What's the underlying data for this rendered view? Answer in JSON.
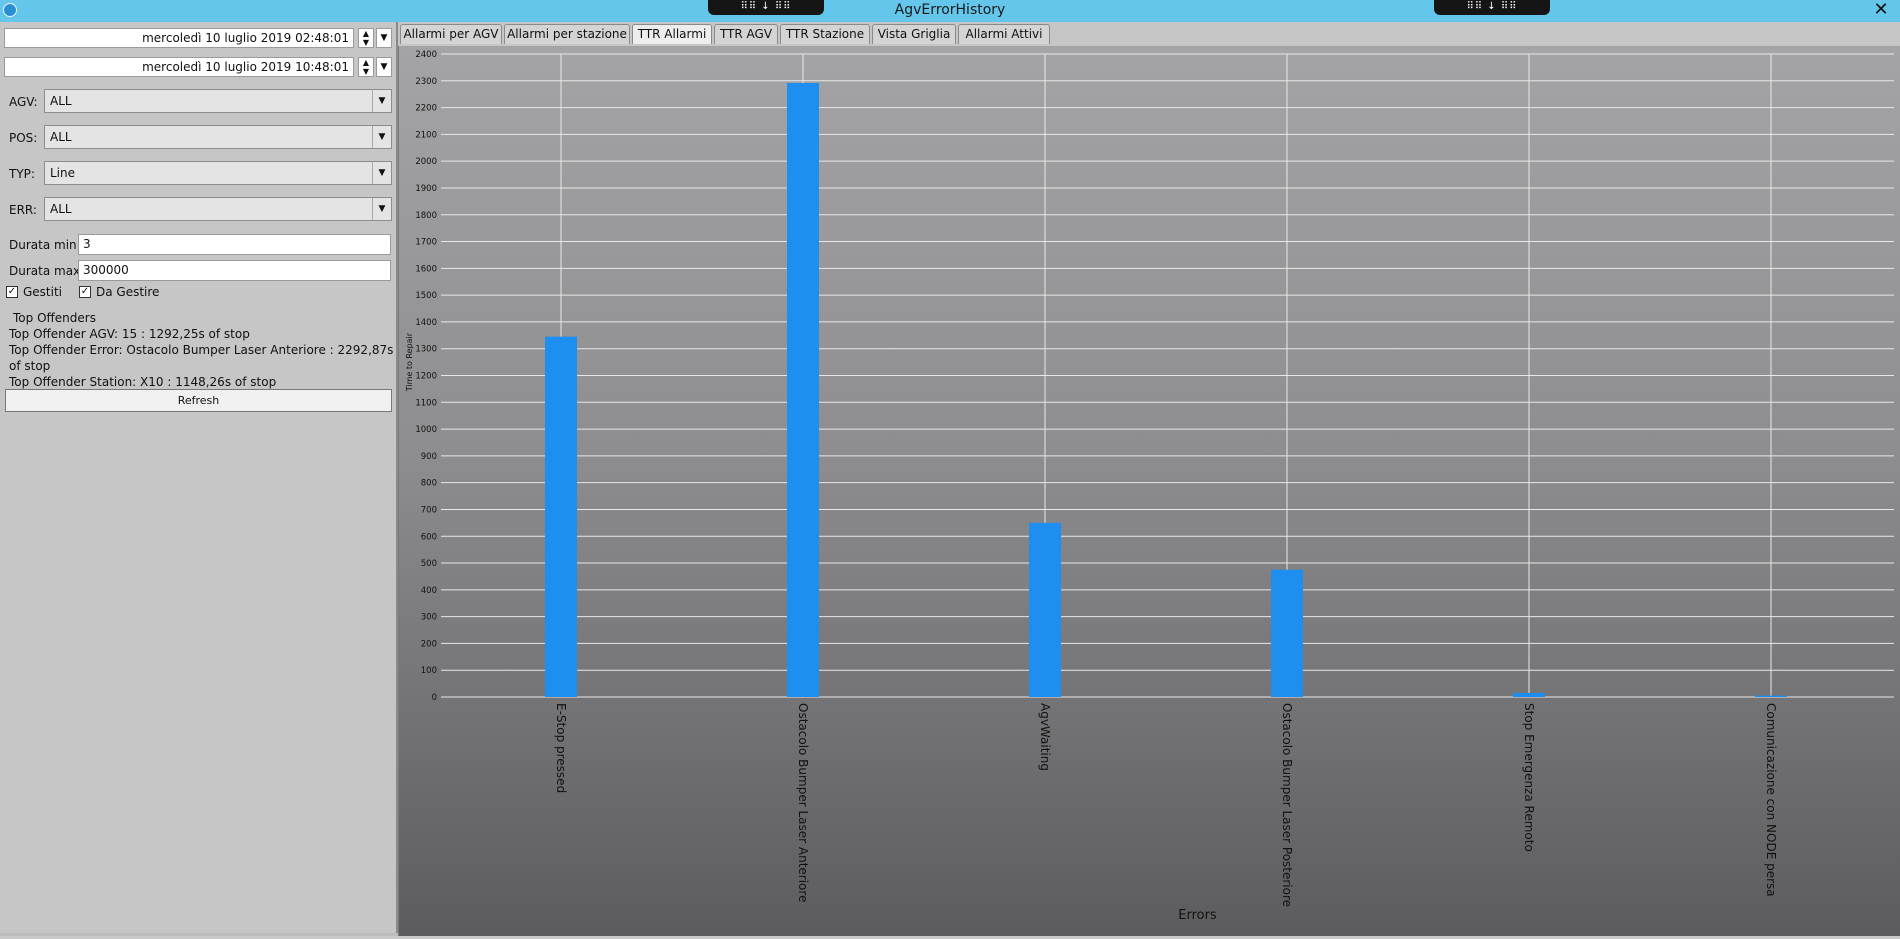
{
  "window": {
    "title": "AgvErrorHistory",
    "close_glyph": "✕",
    "dock_glyph": "⠿⠿ ↓ ⠿⠿"
  },
  "filters": {
    "date_from": "mercoledì 10 luglio 2019 02:48:01",
    "date_to": "mercoledì 10 luglio 2019 10:48:01",
    "agv_label": "AGV:",
    "agv_value": "ALL",
    "pos_label": "POS:",
    "pos_value": "ALL",
    "typ_label": "TYP:",
    "typ_value": "Line",
    "err_label": "ERR:",
    "err_value": "ALL",
    "durata_min_label": "Durata min:",
    "durata_min_value": "3",
    "durata_max_label": "Durata max:",
    "durata_max_value": "300000",
    "gestiti_label": "Gestiti",
    "gestiti_checked": true,
    "da_gestire_label": "Da Gestire",
    "da_gestire_checked": true
  },
  "top_offenders": {
    "heading": "Top Offenders",
    "agv": "Top Offender AGV: 15 : 1292,25s of stop",
    "error": "Top Offender Error: Ostacolo Bumper Laser Anteriore : 2292,87s of stop",
    "station": "Top Offender Station: X10 : 1148,26s of stop"
  },
  "refresh_label": "Refresh",
  "tabs": [
    {
      "label": "Allarmi per AGV",
      "active": false
    },
    {
      "label": "Allarmi per stazione",
      "active": false
    },
    {
      "label": "TTR Allarmi",
      "active": true
    },
    {
      "label": "TTR AGV",
      "active": false
    },
    {
      "label": "TTR Stazione",
      "active": false
    },
    {
      "label": "Vista Griglia",
      "active": false
    },
    {
      "label": "Allarmi Attivi",
      "active": false
    }
  ],
  "colors": {
    "bar": "#1e8ff0",
    "titlebar": "#64c6ea"
  },
  "chart_data": {
    "type": "bar",
    "categories": [
      "E-Stop pressed",
      "Ostacolo Bumper Laser Anteriore",
      "AgvWaiting",
      "Ostacolo Bumper Laser Posteriore",
      "Stop Emergenza Remoto",
      "Comunicazione con NODE persa"
    ],
    "values": [
      1345,
      2292,
      650,
      475,
      15,
      5
    ],
    "xlabel": "Errors",
    "ylabel": "Time to Repair",
    "ylim": [
      0,
      2400
    ],
    "ytick_step": 100,
    "grid": true
  }
}
